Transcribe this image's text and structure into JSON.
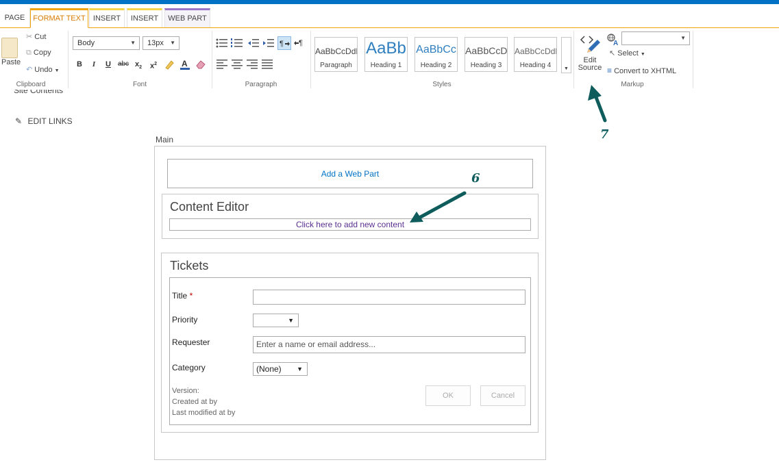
{
  "tabs": [
    "PAGE",
    "FORMAT TEXT",
    "INSERT",
    "INSERT",
    "WEB PART"
  ],
  "ribbon": {
    "clipboard": {
      "paste": "Paste",
      "cut": "Cut",
      "copy": "Copy",
      "undo": "Undo",
      "label": "Clipboard"
    },
    "font": {
      "style_value": "Body",
      "size_value": "13px",
      "bold": "B",
      "italic": "I",
      "underline": "U",
      "strike": "abc",
      "subscript": "x",
      "superscript": "x",
      "sub_mark": "2",
      "sup_mark": "2",
      "label": "Font"
    },
    "paragraph": {
      "label": "Paragraph"
    },
    "styles": {
      "label": "Styles",
      "items": [
        {
          "sample": "AaBbCcDdE",
          "name": "Paragraph"
        },
        {
          "sample": "AaBb",
          "name": "Heading 1"
        },
        {
          "sample": "AaBbCc",
          "name": "Heading 2"
        },
        {
          "sample": "AaBbCcDc",
          "name": "Heading 3"
        },
        {
          "sample": "AaBbCcDdE",
          "name": "Heading 4"
        }
      ]
    },
    "markup": {
      "edit": "Edit",
      "source": "Source",
      "select": "Select",
      "convert": "Convert to XHTML",
      "label": "Markup"
    }
  },
  "left_nav": {
    "site_contents": "Site Contents",
    "edit_links": "EDIT LINKS"
  },
  "main": {
    "zone_label": "Main",
    "add_web_part": "Add a Web Part",
    "content_editor": {
      "title": "Content Editor",
      "link": "Click here to add new content"
    },
    "tickets": {
      "title": "Tickets",
      "fields": {
        "title_label": "Title",
        "required_mark": " *",
        "priority_label": "Priority",
        "requester_label": "Requester",
        "requester_placeholder": "Enter a name or email address...",
        "category_label": "Category",
        "category_value": "(None)"
      },
      "version": "Version:",
      "created": "Created at by",
      "modified": "Last modified at by",
      "ok": "OK",
      "cancel": "Cancel"
    }
  },
  "annotations": {
    "six": "6",
    "seven": "7"
  },
  "colors": {
    "accent": "#0072c6",
    "tab_highlight": "#f0a30a",
    "arrow": "#0e5c5c",
    "link_visited": "#5b2f91"
  }
}
